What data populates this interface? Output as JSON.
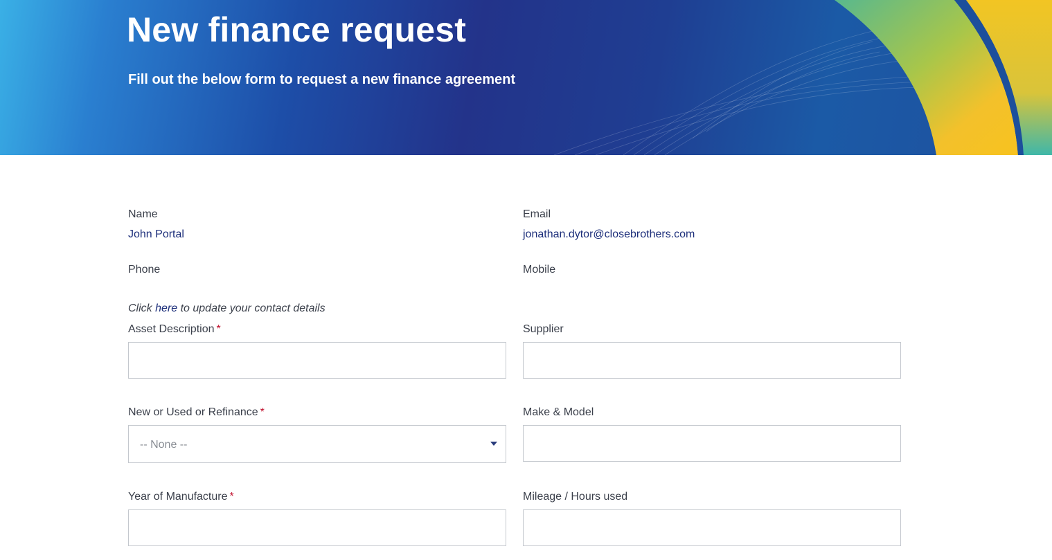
{
  "header": {
    "title": "New finance request",
    "subtitle": "Fill out the below form to request a new finance agreement"
  },
  "contact": {
    "name_label": "Name",
    "name_value": "John Portal",
    "email_label": "Email",
    "email_value": "jonathan.dytor@closebrothers.com",
    "phone_label": "Phone",
    "mobile_label": "Mobile",
    "update_prefix": "Click ",
    "update_link": "here",
    "update_suffix": " to update your contact details"
  },
  "form": {
    "required_marker": "*",
    "asset_description_label": "Asset Description",
    "supplier_label": "Supplier",
    "condition_label": "New or Used or Refinance",
    "condition_selected": "-- None --",
    "make_model_label": "Make & Model",
    "year_label": "Year of Manufacture",
    "mileage_label": "Mileage / Hours used"
  },
  "colors": {
    "accent_link": "#1c2e7a",
    "required": "#c00f2c",
    "hero_dark": "#23338a",
    "hero_light": "#3ab0e6"
  }
}
